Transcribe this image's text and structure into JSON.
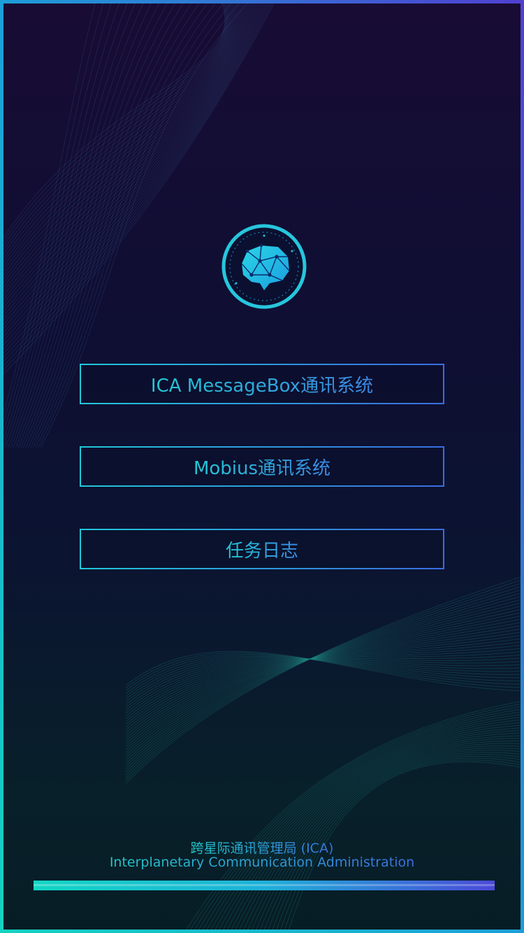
{
  "menu": {
    "items": [
      {
        "label": "ICA MessageBox通讯系统"
      },
      {
        "label": "Mobius通讯系统"
      },
      {
        "label": "任务日志"
      }
    ]
  },
  "footer": {
    "org_cn": "跨星际通讯管理局 (ICA)",
    "org_en": "Interplanetary Communication Administration"
  },
  "colors": {
    "accent_cyan": "#22c9d2",
    "accent_blue": "#3b6de0",
    "background_top": "#180c34",
    "background_bottom": "#071d26"
  },
  "icons": {
    "logo": "brain-network-chat-icon"
  }
}
